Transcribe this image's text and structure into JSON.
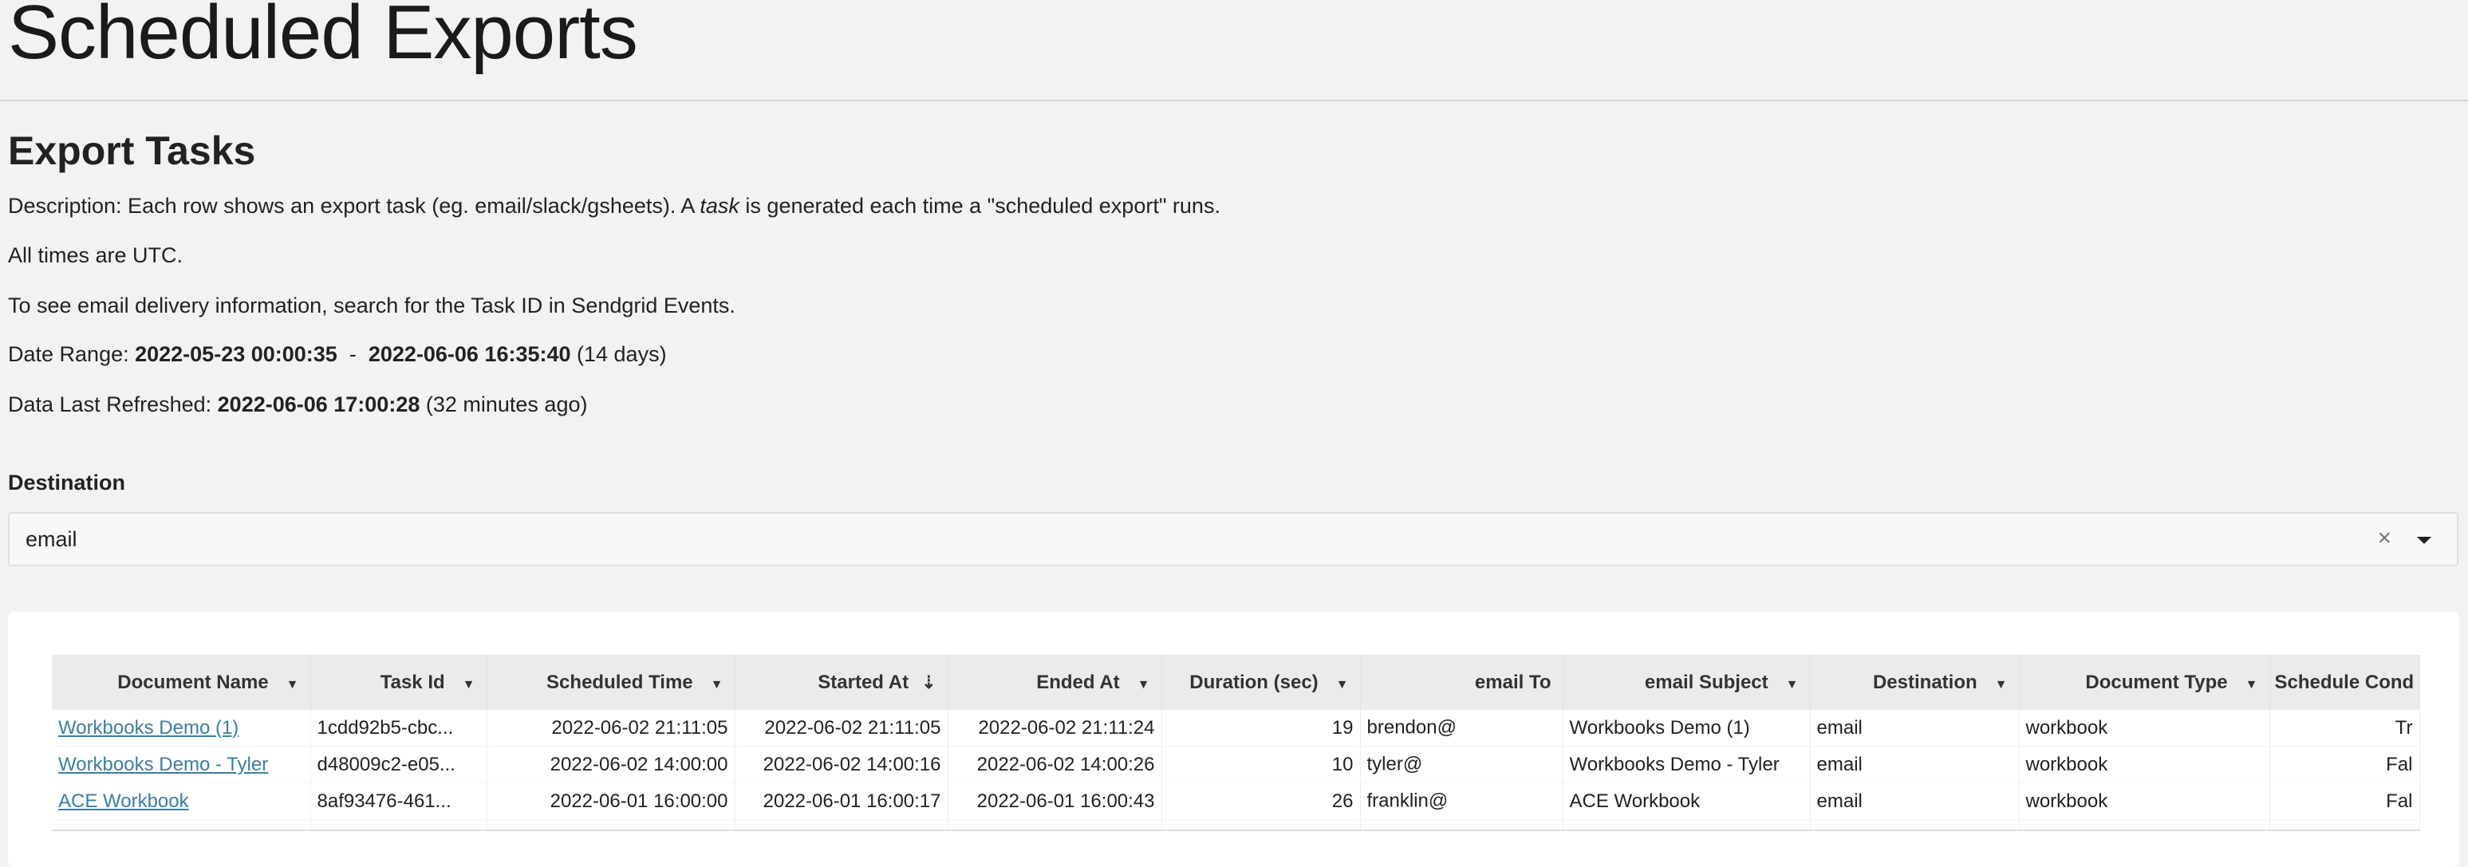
{
  "page_title": "Scheduled Exports",
  "section_title": "Export Tasks",
  "description": {
    "prefix": "Description: Each row shows an export task (eg. email/slack/gsheets). A ",
    "italic": "task",
    "suffix": " is generated each time a \"scheduled export\" runs."
  },
  "utc_note": "All times are UTC.",
  "sendgrid_note": "To see email delivery information, search for the Task ID in Sendgrid Events.",
  "date_range": {
    "label": "Date Range: ",
    "start": "2022-05-23 00:00:35",
    "sep": "  -  ",
    "end": "2022-06-06 16:35:40",
    "span": " (14 days)"
  },
  "refreshed": {
    "label": "Data Last Refreshed: ",
    "value": "2022-06-06 17:00:28",
    "ago": " (32 minutes ago)"
  },
  "destination_filter": {
    "label": "Destination",
    "value": "email",
    "clear_icon": "×"
  },
  "table": {
    "columns": [
      "Document Name",
      "Task Id",
      "Scheduled Time",
      "Started At",
      "Ended At",
      "Duration (sec)",
      "email To",
      "email Subject",
      "Destination",
      "Document Type",
      "Schedule Cond"
    ],
    "sorted_column": "Started At",
    "rows": [
      {
        "doc": "Workbooks Demo (1)",
        "task": "1cdd92b5-cbc...",
        "scheduled": "2022-06-02 21:11:05",
        "started": "2022-06-02 21:11:05",
        "ended": "2022-06-02 21:11:24",
        "duration": "19",
        "to": "brendon@",
        "subject": "Workbooks Demo (1)",
        "dest": "email",
        "type": "workbook",
        "cond": "Tr"
      },
      {
        "doc": "Workbooks Demo - Tyler",
        "task": "d48009c2-e05...",
        "scheduled": "2022-06-02 14:00:00",
        "started": "2022-06-02 14:00:16",
        "ended": "2022-06-02 14:00:26",
        "duration": "10",
        "to": "tyler@",
        "subject": "Workbooks Demo - Tyler",
        "dest": "email",
        "type": "workbook",
        "cond": "Fal"
      },
      {
        "doc": "ACE Workbook",
        "task": "8af93476-461...",
        "scheduled": "2022-06-01 16:00:00",
        "started": "2022-06-01 16:00:17",
        "ended": "2022-06-01 16:00:43",
        "duration": "26",
        "to": "franklin@",
        "subject": "ACE Workbook",
        "dest": "email",
        "type": "workbook",
        "cond": "Fal"
      }
    ]
  }
}
